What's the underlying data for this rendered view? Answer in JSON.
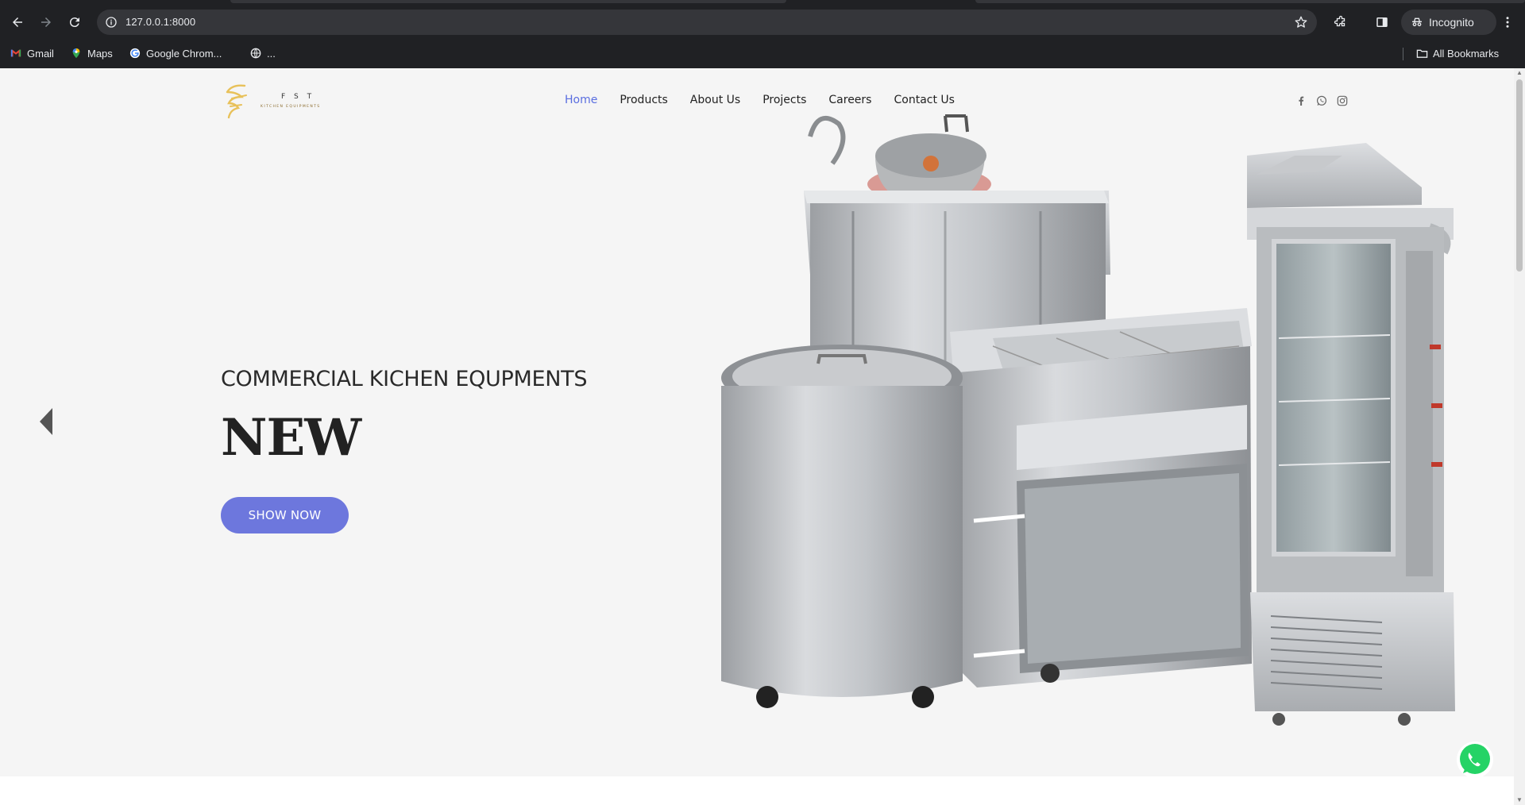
{
  "browser": {
    "url": "127.0.0.1:8000",
    "incognito_label": "Incognito",
    "bookmarks": [
      {
        "label": "Gmail",
        "icon": "gmail-icon"
      },
      {
        "label": "Maps",
        "icon": "maps-icon"
      },
      {
        "label": "Google Chrom...",
        "icon": "google-icon"
      },
      {
        "label": "...",
        "icon": "globe-icon"
      }
    ],
    "all_bookmarks_label": "All Bookmarks"
  },
  "site": {
    "logo_letters": "F S T",
    "logo_tagline": "KITCHEN EQUIPMENTS",
    "nav": [
      {
        "label": "Home",
        "active": true
      },
      {
        "label": "Products",
        "active": false
      },
      {
        "label": "About Us",
        "active": false
      },
      {
        "label": "Projects",
        "active": false
      },
      {
        "label": "Careers",
        "active": false
      },
      {
        "label": "Contact Us",
        "active": false
      }
    ],
    "social": [
      "facebook-icon",
      "whatsapp-icon",
      "instagram-icon"
    ]
  },
  "hero": {
    "subtitle": "COMMERCIAL KICHEN EQUPMENTS",
    "title": "NEW",
    "button": "SHOW NOW"
  },
  "colors": {
    "accent": "#6d77dd",
    "nav_active": "#5a6ee0",
    "logo_gold": "#e8c15a",
    "whatsapp": "#25d366"
  }
}
